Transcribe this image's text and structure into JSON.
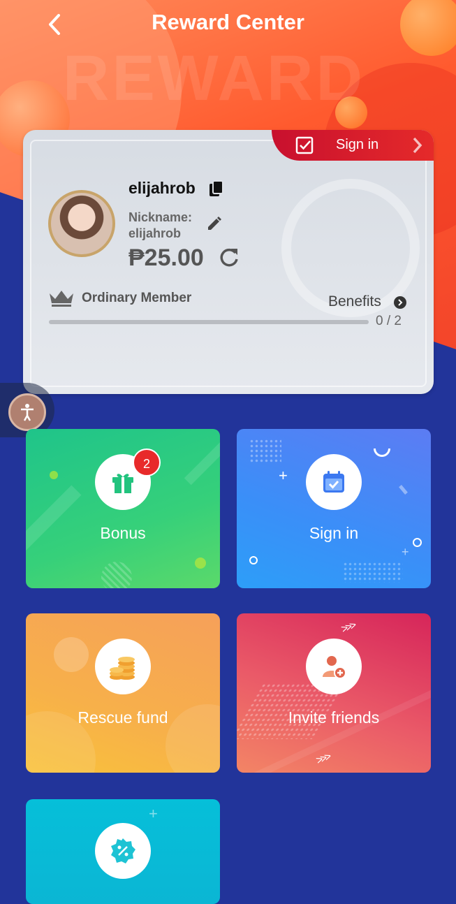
{
  "header": {
    "title": "Reward Center",
    "watermark": "REWARD"
  },
  "card": {
    "signin_label": "Sign in",
    "username": "elijahrob",
    "nickname_label": "Nickname:",
    "nickname_value": "elijahrob",
    "balance": "₱25.00",
    "member_level": "Ordinary Member",
    "benefits_label": "Benefits",
    "progress_text": "0 / 2",
    "progress_fraction": 0
  },
  "tiles": [
    {
      "label": "Bonus",
      "badge": "2"
    },
    {
      "label": "Sign in"
    },
    {
      "label": "Rescue fund"
    },
    {
      "label": "Invite friends"
    },
    {
      "label": ""
    }
  ],
  "colors": {
    "hero": "#ff5a2e",
    "background": "#22349a",
    "signin_tab": "#d81f2c",
    "badge": "#e82a2a"
  }
}
